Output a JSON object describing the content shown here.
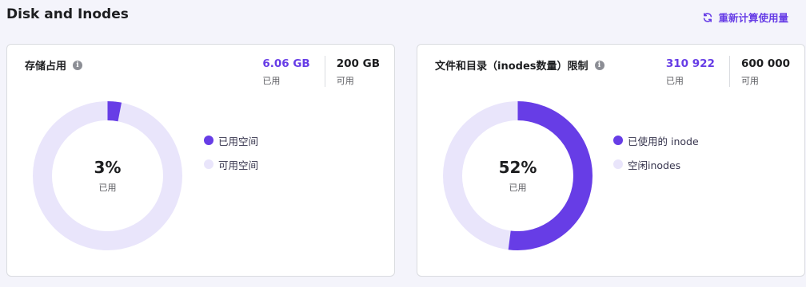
{
  "header": {
    "title": "Disk and Inodes",
    "recalc_label": "重新计算使用量"
  },
  "colors": {
    "accent": "#673de6",
    "track": "#e9e5fb"
  },
  "storage": {
    "title": "存储占用",
    "used_value": "6.06 GB",
    "used_label": "已用",
    "available_value": "200 GB",
    "available_label": "可用",
    "percent": 3,
    "percent_text": "3%",
    "center_label": "已用",
    "legend": [
      {
        "label": "已用空间",
        "color": "#673de6"
      },
      {
        "label": "可用空间",
        "color": "#e9e5fb"
      }
    ]
  },
  "inodes": {
    "title": "文件和目录（inodes数量）限制",
    "used_value": "310 922",
    "used_label": "已用",
    "available_value": "600 000",
    "available_label": "可用",
    "percent": 52,
    "percent_text": "52%",
    "center_label": "已用",
    "legend": [
      {
        "label": "已使用的 inode",
        "color": "#673de6"
      },
      {
        "label": "空闲inodes",
        "color": "#e9e5fb"
      }
    ]
  }
}
